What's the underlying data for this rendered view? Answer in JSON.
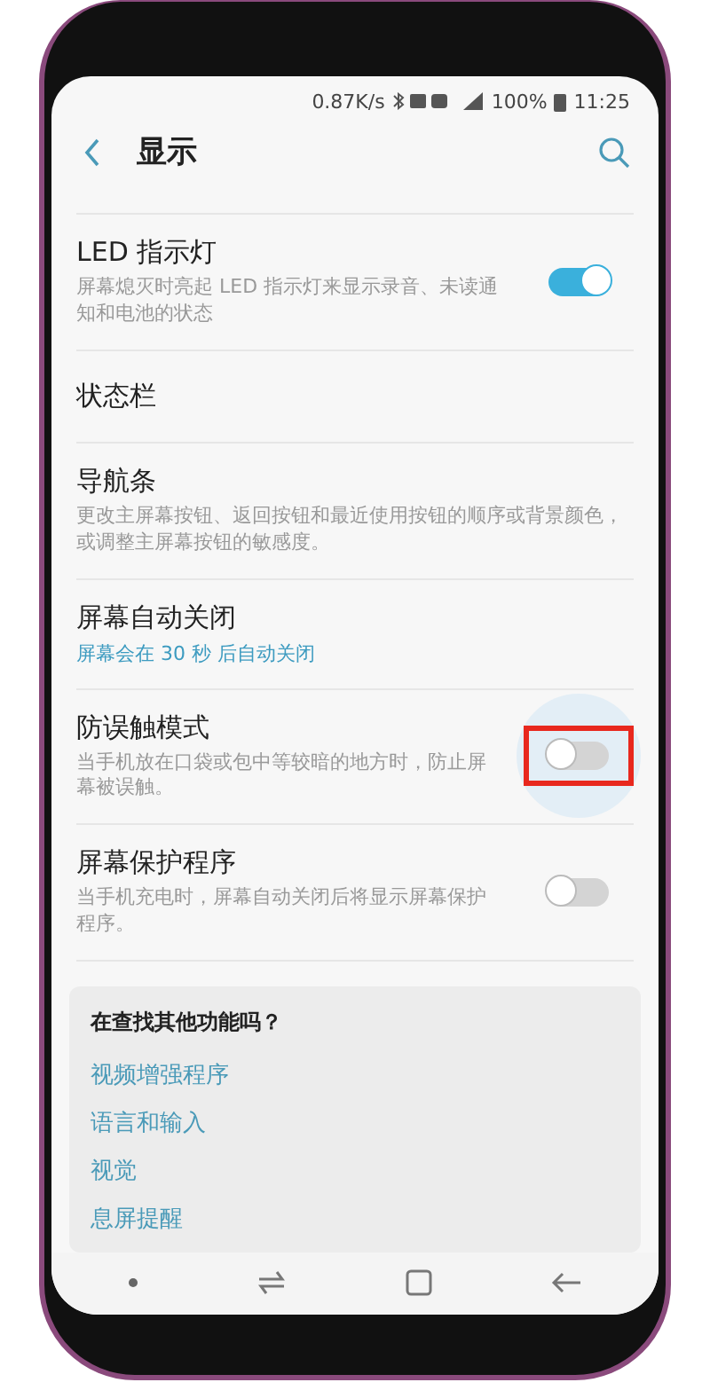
{
  "status_bar": {
    "speed": "0.87K/s",
    "battery": "100%",
    "time": "11:25"
  },
  "header": {
    "title": "显示"
  },
  "settings": [
    {
      "title": "LED 指示灯",
      "summary": "屏幕熄灭时亮起 LED 指示灯来显示录音、未读通知和电池的状态",
      "kind": "toggle",
      "on": true,
      "highlighted": false
    },
    {
      "title": "状态栏",
      "kind": "plain"
    },
    {
      "title": "导航条",
      "summary": "更改主屏幕按钮、返回按钮和最近使用按钮的顺序或背景颜色，或调整主屏幕按钮的敏感度。",
      "kind": "plain"
    },
    {
      "title": "屏幕自动关闭",
      "value": "屏幕会在 30 秒 后自动关闭",
      "kind": "plain"
    },
    {
      "title": "防误触模式",
      "summary": "当手机放在口袋或包中等较暗的地方时，防止屏幕被误触。",
      "kind": "toggle",
      "on": false,
      "highlighted": true
    },
    {
      "title": "屏幕保护程序",
      "summary": "当手机充电时，屏幕自动关闭后将显示屏幕保护程序。",
      "kind": "toggle",
      "on": false,
      "highlighted": false
    }
  ],
  "suggestions": {
    "title": "在查找其他功能吗？",
    "links": [
      "视频增强程序",
      "语言和输入",
      "视觉",
      "息屏提醒"
    ]
  }
}
